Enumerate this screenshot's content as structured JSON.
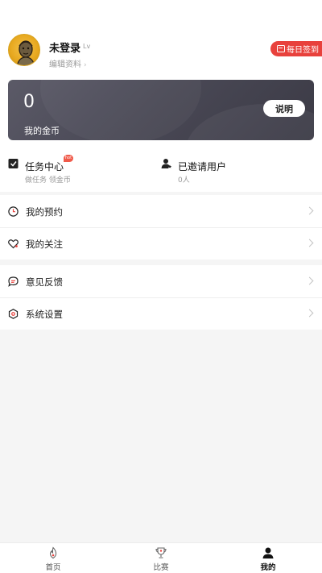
{
  "profile": {
    "name": "未登录",
    "level": "Lv",
    "edit_label": "编辑资料",
    "signin_label": "每日签到"
  },
  "coins": {
    "value": "0",
    "label": "我的金币",
    "explain_label": "说明"
  },
  "quick": {
    "tasks": {
      "title": "任务中心",
      "subtitle": "做任务 领金币",
      "badge": "hot"
    },
    "invited": {
      "title": "已邀请用户",
      "subtitle": "0人"
    }
  },
  "menu_group1": [
    {
      "label": "我的预约",
      "icon": "clock-icon"
    },
    {
      "label": "我的关注",
      "icon": "heart-icon"
    }
  ],
  "menu_group2": [
    {
      "label": "意见反馈",
      "icon": "chat-bubble-icon"
    },
    {
      "label": "系统设置",
      "icon": "settings-hexagon-icon"
    }
  ],
  "tabbar": [
    {
      "label": "首页",
      "icon": "flame-icon"
    },
    {
      "label": "比赛",
      "icon": "trophy-icon"
    },
    {
      "label": "我的",
      "icon": "user-icon",
      "active": true
    }
  ],
  "colors": {
    "accent_red": "#e8413c",
    "card_dark": "#4a4956"
  }
}
